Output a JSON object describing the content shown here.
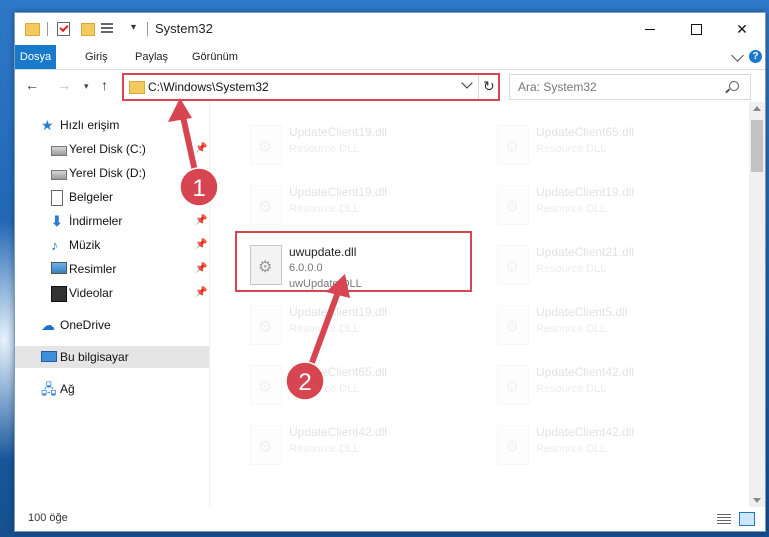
{
  "window": {
    "title": "System32"
  },
  "ribbon": {
    "tabs": [
      "Dosya",
      "Giriş",
      "Paylaş",
      "Görünüm"
    ]
  },
  "address": {
    "path": "C:\\Windows\\System32"
  },
  "search": {
    "placeholder": "Ara: System32"
  },
  "nav": {
    "quick_access": "Hızlı erişim",
    "items": [
      {
        "label": "Yerel Disk (C:)",
        "icon": "drive-icon",
        "pinned": true
      },
      {
        "label": "Yerel Disk (D:)",
        "icon": "drive-icon",
        "pinned": false
      },
      {
        "label": "Belgeler",
        "icon": "documents-icon",
        "pinned": true
      },
      {
        "label": "İndirmeler",
        "icon": "downloads-icon",
        "pinned": true
      },
      {
        "label": "Müzik",
        "icon": "music-icon",
        "pinned": true
      },
      {
        "label": "Resimler",
        "icon": "pictures-icon",
        "pinned": true
      },
      {
        "label": "Videolar",
        "icon": "videos-icon",
        "pinned": true
      }
    ],
    "onedrive": "OneDrive",
    "this_pc": "Bu bilgisayar",
    "network": "Ağ"
  },
  "files": {
    "highlighted": {
      "name": "uwupdate.dll",
      "version": "6.0.0.0",
      "description": "uwUpdate DLL"
    },
    "faded": [
      {
        "name": "UpdateClient19.dll",
        "description": "Resource DLL"
      },
      {
        "name": "UpdateClient65.dll",
        "description": "Resource DLL"
      },
      {
        "name": "UpdateClient19.dll",
        "description": "Resource DLL"
      },
      {
        "name": "UpdateClient19.dll",
        "description": "Resource DLL"
      },
      {
        "name": "UpdateClient21.dll",
        "description": "Resource DLL"
      },
      {
        "name": "UpdateClient19.dll",
        "description": "Resource DLL"
      },
      {
        "name": "UpdateClient5.dll",
        "description": "Resource DLL"
      },
      {
        "name": "UpdateClient65.dll",
        "description": "Resource DLL"
      },
      {
        "name": "UpdateClient42.dll",
        "description": "Resource DLL"
      },
      {
        "name": "UpdateClient42.dll",
        "description": "Resource DLL"
      },
      {
        "name": "UpdateClient42.dll",
        "description": "Resource DLL"
      }
    ]
  },
  "status": {
    "item_count": "100 öğe"
  },
  "annotations": {
    "step1": "1",
    "step2": "2",
    "color": "#d64550"
  }
}
